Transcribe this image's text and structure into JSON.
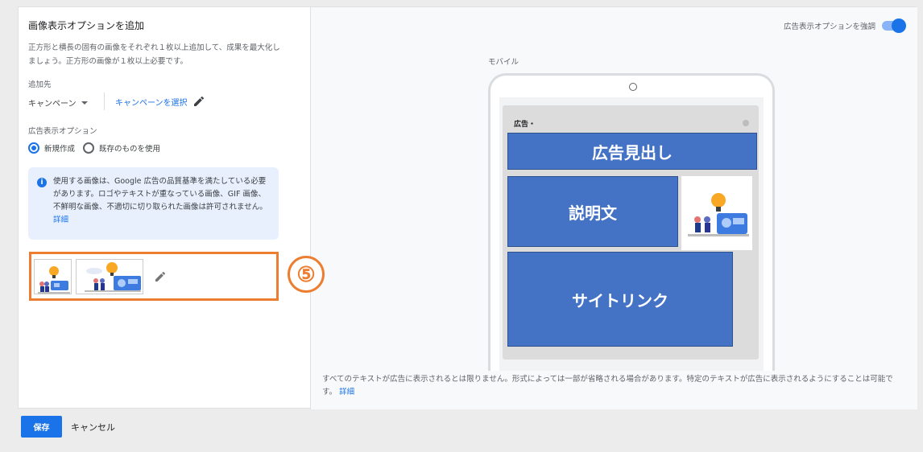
{
  "form": {
    "title": "画像表示オプションを追加",
    "description": "正方形と横長の固有の画像をそれぞれ１枚以上追加して、成果を最大化しましょう。正方形の画像が１枚以上必要です。",
    "add_to_label": "追加先",
    "level_value": "キャンペーン",
    "select_campaign_label": "キャンペーンを選択",
    "extension_label": "広告表示オプション",
    "radio_new": "新規作成",
    "radio_existing": "既存のものを使用",
    "info_text": "使用する画像は、Google 広告の品質基準を満たしている必要があります。ロゴやテキストが重なっている画像、GIF 画像、不鮮明な画像、不適切に切り取られた画像は許可されません。",
    "info_link": "詳細"
  },
  "annotation": {
    "step_number": "⑤"
  },
  "preview": {
    "emphasize_label": "広告表示オプションを強調",
    "device_label": "モバイル",
    "ad_label": "広告・",
    "headline": "広告見出し",
    "description": "説明文",
    "sitelinks": "サイトリンク",
    "footnote": "すべてのテキストが広告に表示されるとは限りません。形式によっては一部が省略される場合があります。特定のテキストが広告に表示されるようにすることは可能です。",
    "footnote_link": "詳細"
  },
  "actions": {
    "save": "保存",
    "cancel": "キャンセル"
  },
  "colors": {
    "accent": "#1a73e8",
    "highlight": "#ed7d31",
    "block": "#4472c4"
  }
}
